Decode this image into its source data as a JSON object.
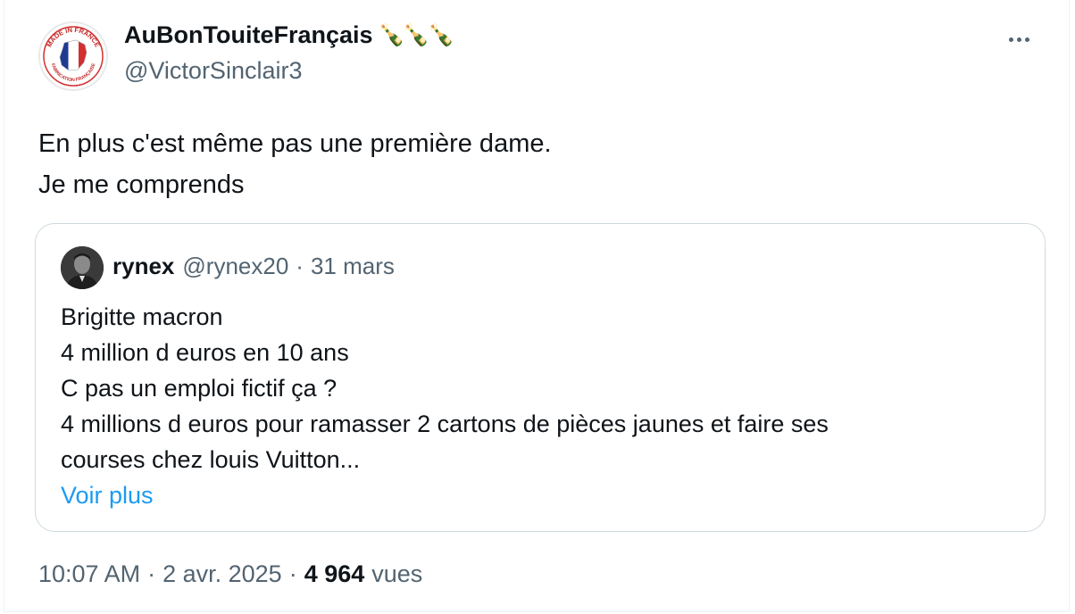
{
  "tweet": {
    "author_name": "AuBonTouiteFrançais",
    "author_emoji": "🍾🍾🍾",
    "author_handle": "@VictorSinclair3",
    "avatar_icon": "made-in-france-badge",
    "avatar_badge_top": "MADE IN FRANCE",
    "avatar_badge_bottom": "FABRICATION FRANÇAISE",
    "text_lines": [
      "En plus c'est même pas une première dame.",
      "Je me comprends"
    ]
  },
  "quote": {
    "name": "rynex",
    "handle": "@rynex20",
    "separator": "·",
    "date": "31 mars",
    "text_lines": [
      "Brigitte macron",
      "4 million d euros en 10 ans",
      "C pas un emploi fictif ça ?",
      "4 millions d euros pour ramasser  2 cartons de pièces jaunes et faire ses",
      "courses chez louis Vuitton..."
    ],
    "show_more_label": "Voir plus"
  },
  "meta": {
    "time": "10:07 AM",
    "separator": "·",
    "date": "2 avr. 2025",
    "views_count": "4 964",
    "views_label": "vues"
  },
  "colors": {
    "text_primary": "#0f1419",
    "text_secondary": "#536471",
    "link": "#1d9bf0",
    "border": "#cfd9de"
  }
}
